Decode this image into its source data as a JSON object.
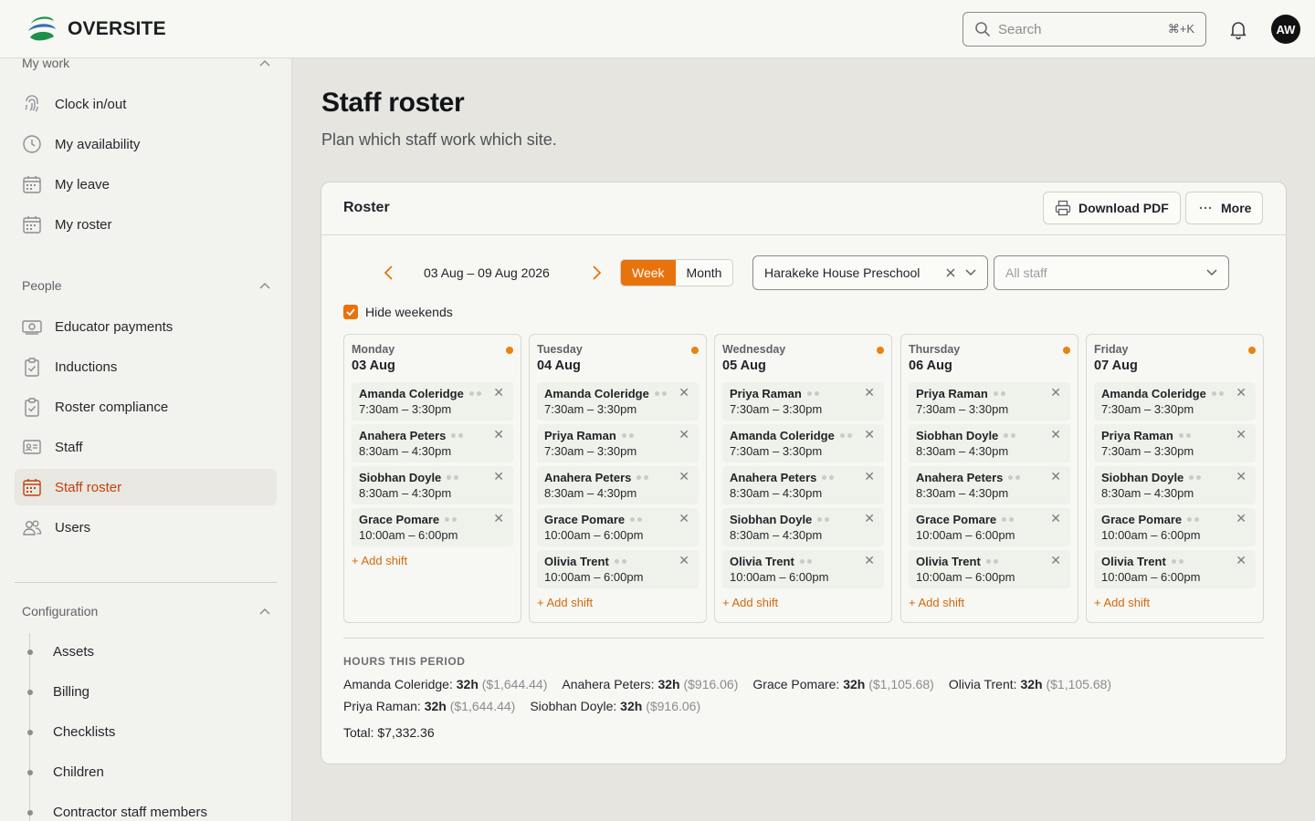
{
  "app": {
    "name": "OVERSITE"
  },
  "header": {
    "search_placeholder": "Search",
    "search_shortcut": "⌘+K",
    "avatar_initials": "AW"
  },
  "sidebar": {
    "my_work": {
      "title": "My work",
      "items": [
        {
          "label": "Clock in/out",
          "icon": "fingerprint-icon"
        },
        {
          "label": "My availability",
          "icon": "clock-icon"
        },
        {
          "label": "My leave",
          "icon": "calendar-icon"
        },
        {
          "label": "My roster",
          "icon": "calendar-icon"
        }
      ]
    },
    "people": {
      "title": "People",
      "items": [
        {
          "label": "Educator payments",
          "icon": "payment-icon"
        },
        {
          "label": "Inductions",
          "icon": "clipboard-check-icon"
        },
        {
          "label": "Roster compliance",
          "icon": "clipboard-check-icon"
        },
        {
          "label": "Staff",
          "icon": "id-card-icon"
        },
        {
          "label": "Staff roster",
          "icon": "calendar-icon",
          "active": true
        },
        {
          "label": "Users",
          "icon": "users-icon"
        }
      ]
    },
    "configuration": {
      "title": "Configuration",
      "items": [
        "Assets",
        "Billing",
        "Checklists",
        "Children",
        "Contractor staff members"
      ]
    }
  },
  "page": {
    "title": "Staff roster",
    "subtitle": "Plan which staff work which site."
  },
  "roster": {
    "title": "Roster",
    "download_label": "Download PDF",
    "more_label": "More",
    "date_range": "03 Aug – 09 Aug 2026",
    "view_week": "Week",
    "view_month": "Month",
    "site": "Harakeke House Preschool",
    "staff_placeholder": "All staff",
    "hide_weekends": "Hide weekends",
    "add_shift": "+ Add shift",
    "days": [
      {
        "name": "Monday",
        "date": "03 Aug",
        "shifts": [
          {
            "name": "Amanda Coleridge",
            "time": "7:30am – 3:30pm"
          },
          {
            "name": "Anahera Peters",
            "time": "8:30am – 4:30pm"
          },
          {
            "name": "Siobhan Doyle",
            "time": "8:30am – 4:30pm"
          },
          {
            "name": "Grace Pomare",
            "time": "10:00am – 6:00pm"
          }
        ]
      },
      {
        "name": "Tuesday",
        "date": "04 Aug",
        "shifts": [
          {
            "name": "Amanda Coleridge",
            "time": "7:30am – 3:30pm"
          },
          {
            "name": "Priya Raman",
            "time": "7:30am – 3:30pm"
          },
          {
            "name": "Anahera Peters",
            "time": "8:30am – 4:30pm"
          },
          {
            "name": "Grace Pomare",
            "time": "10:00am – 6:00pm"
          },
          {
            "name": "Olivia Trent",
            "time": "10:00am – 6:00pm"
          }
        ]
      },
      {
        "name": "Wednesday",
        "date": "05 Aug",
        "shifts": [
          {
            "name": "Priya Raman",
            "time": "7:30am – 3:30pm"
          },
          {
            "name": "Amanda Coleridge",
            "time": "7:30am – 3:30pm"
          },
          {
            "name": "Anahera Peters",
            "time": "8:30am – 4:30pm"
          },
          {
            "name": "Siobhan Doyle",
            "time": "8:30am – 4:30pm"
          },
          {
            "name": "Olivia Trent",
            "time": "10:00am – 6:00pm"
          }
        ]
      },
      {
        "name": "Thursday",
        "date": "06 Aug",
        "shifts": [
          {
            "name": "Priya Raman",
            "time": "7:30am – 3:30pm"
          },
          {
            "name": "Siobhan Doyle",
            "time": "8:30am – 4:30pm"
          },
          {
            "name": "Anahera Peters",
            "time": "8:30am – 4:30pm"
          },
          {
            "name": "Grace Pomare",
            "time": "10:00am – 6:00pm"
          },
          {
            "name": "Olivia Trent",
            "time": "10:00am – 6:00pm"
          }
        ]
      },
      {
        "name": "Friday",
        "date": "07 Aug",
        "shifts": [
          {
            "name": "Amanda Coleridge",
            "time": "7:30am – 3:30pm"
          },
          {
            "name": "Priya Raman",
            "time": "7:30am – 3:30pm"
          },
          {
            "name": "Siobhan Doyle",
            "time": "8:30am – 4:30pm"
          },
          {
            "name": "Grace Pomare",
            "time": "10:00am – 6:00pm"
          },
          {
            "name": "Olivia Trent",
            "time": "10:00am – 6:00pm"
          }
        ]
      }
    ],
    "hours_title": "HOURS THIS PERIOD",
    "hours_rows": [
      [
        {
          "name": "Amanda Coleridge:",
          "hours": "32h",
          "amount": "($1,644.44)"
        },
        {
          "name": "Anahera Peters:",
          "hours": "32h",
          "amount": "($916.06)"
        },
        {
          "name": "Grace Pomare:",
          "hours": "32h",
          "amount": "($1,105.68)"
        },
        {
          "name": "Olivia Trent:",
          "hours": "32h",
          "amount": "($1,105.68)"
        }
      ],
      [
        {
          "name": "Priya Raman:",
          "hours": "32h",
          "amount": "($1,644.44)"
        },
        {
          "name": "Siobhan Doyle:",
          "hours": "32h",
          "amount": "($916.06)"
        }
      ]
    ],
    "total": "Total: $7,332.36"
  },
  "colors": {
    "accent": "#e8730c",
    "accent_text": "#c2410c"
  }
}
